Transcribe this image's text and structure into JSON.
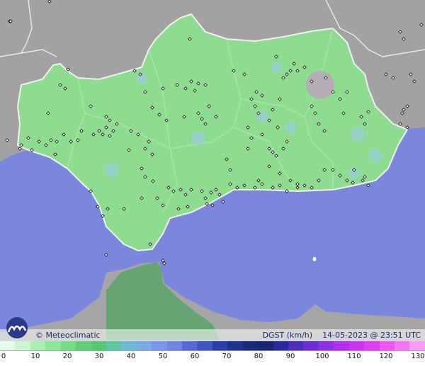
{
  "brand": "© Meteoclimatic",
  "variable": "DGST (km/h)",
  "timestamp": "14-05-2023 @ 23:51 UTC",
  "legend": {
    "ticks": [
      "0",
      "10",
      "20",
      "30",
      "40",
      "50",
      "60",
      "70",
      "80",
      "90",
      "100",
      "110",
      "120",
      "130"
    ],
    "colors": [
      "#e6fbe9",
      "#c9f5d0",
      "#a9efb4",
      "#8de69a",
      "#77dc86",
      "#62cf78",
      "#57c774",
      "#5ec6a0",
      "#70b9d6",
      "#7aa9e6",
      "#7b95e8",
      "#7284e0",
      "#5a68d4",
      "#3f55bf",
      "#2a3fa6",
      "#1e338e",
      "#182a78",
      "#1a2470",
      "#2a2a9a",
      "#4a2fb8",
      "#6b2fd0",
      "#8e2fe0",
      "#b02fe8",
      "#cc33ee",
      "#e03ef0",
      "#ee55f2",
      "#f376f4",
      "#f79cf7"
    ]
  },
  "colors": {
    "sea": "#7b86dd",
    "land_grey": "#a4a4a4",
    "andalusia": "#8ddc8f",
    "africa": "#5aaa6c",
    "border": "#e8e8e8"
  }
}
